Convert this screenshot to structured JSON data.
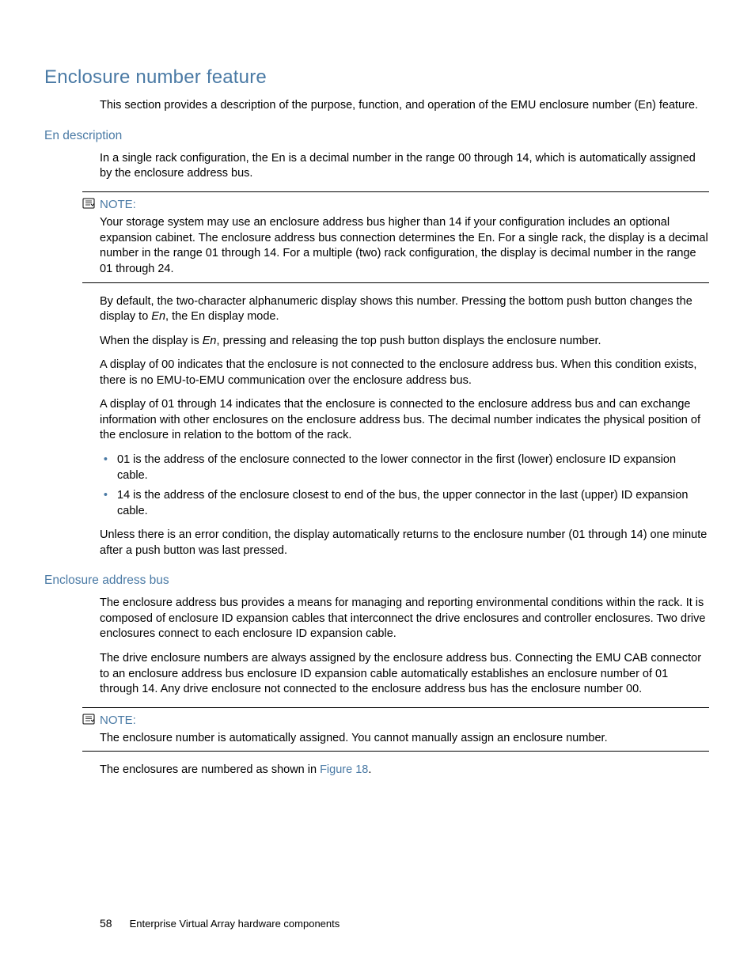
{
  "heading1": "Enclosure number feature",
  "intro": "This section provides a description of the purpose, function, and operation of the EMU enclosure number (En) feature.",
  "sec1": {
    "title": "En description",
    "p1": "In a single rack configuration, the En is a decimal number in the range 00 through 14, which is automatically assigned by the enclosure address bus.",
    "note_label": "NOTE:",
    "note_body": "Your storage system may use an enclosure address bus higher than 14 if your configuration includes an optional expansion cabinet. The enclosure address bus connection determines the En. For a single rack, the display is a decimal number in the range 01 through 14. For a multiple (two) rack configuration, the display is decimal number in the range 01 through 24.",
    "p2a": "By default, the two-character alphanumeric display shows this number. Pressing the bottom push button changes the display to ",
    "p2_em": "En",
    "p2b": ", the En display mode.",
    "p3a": "When the display is ",
    "p3_em": "En",
    "p3b": ", pressing and releasing the top push button displays the enclosure number.",
    "p4": "A display of 00 indicates that the enclosure is not connected to the enclosure address bus. When this condition exists, there is no EMU-to-EMU communication over the enclosure address bus.",
    "p5": "A display of 01 through 14 indicates that the enclosure is connected to the enclosure address bus and can exchange information with other enclosures on the enclosure address bus. The decimal number indicates the physical position of the enclosure in relation to the bottom of the rack.",
    "li1": "01 is the address of the enclosure connected to the lower connector in the first (lower) enclosure ID expansion cable.",
    "li2": "14 is the address of the enclosure closest to end of the bus, the upper connector in the last (upper) ID expansion cable.",
    "p6": "Unless there is an error condition, the display automatically returns to the enclosure number (01 through 14) one minute after a push button was last pressed."
  },
  "sec2": {
    "title": "Enclosure address bus",
    "p1": "The enclosure address bus provides a means for managing and reporting environmental conditions within the rack. It is composed of enclosure ID expansion cables that interconnect the drive enclosures and controller enclosures. Two drive enclosures connect to each enclosure ID expansion cable.",
    "p2": "The drive enclosure numbers are always assigned by the enclosure address bus. Connecting the EMU CAB connector to an enclosure address bus enclosure ID expansion cable automatically establishes an enclosure number of 01 through 14. Any drive enclosure not connected to the enclosure address bus has the enclosure number 00.",
    "note_label": "NOTE:",
    "note_body": "The enclosure number is automatically assigned. You cannot manually assign an enclosure number.",
    "p3a": "The enclosures are numbered as shown in ",
    "p3_xref": "Figure 18",
    "p3b": "."
  },
  "footer": {
    "page": "58",
    "title": "Enterprise Virtual Array hardware components"
  }
}
